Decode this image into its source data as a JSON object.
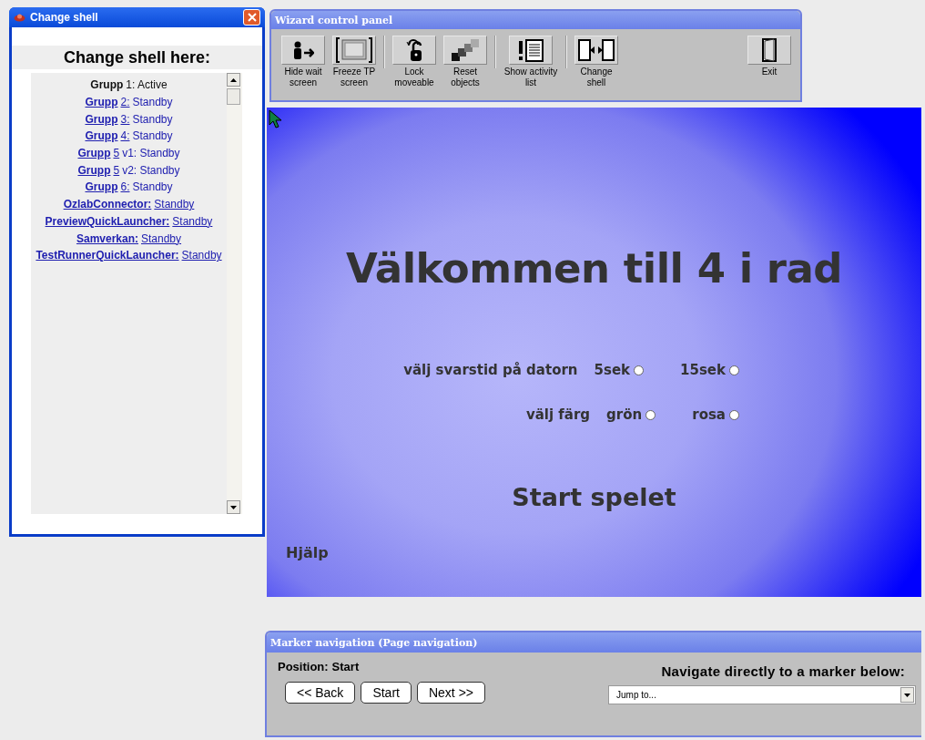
{
  "shell_window": {
    "title": "Change shell",
    "heading": "Change shell here:",
    "items": [
      {
        "active": true,
        "parts": [
          {
            "text": "Grupp",
            "bold": true,
            "link": false
          },
          {
            "text": "1: Active",
            "bold": false,
            "link": false
          }
        ]
      },
      {
        "active": false,
        "parts": [
          {
            "text": "Grupp",
            "bold": true,
            "link": true
          },
          {
            "text": "2:",
            "bold": false,
            "link": true
          },
          {
            "text": "Standby",
            "bold": false,
            "link": false
          }
        ]
      },
      {
        "active": false,
        "parts": [
          {
            "text": "Grupp",
            "bold": true,
            "link": true
          },
          {
            "text": "3:",
            "bold": false,
            "link": true
          },
          {
            "text": "Standby",
            "bold": false,
            "link": false
          }
        ]
      },
      {
        "active": false,
        "parts": [
          {
            "text": "Grupp",
            "bold": true,
            "link": true
          },
          {
            "text": "4:",
            "bold": false,
            "link": true
          },
          {
            "text": "Standby",
            "bold": false,
            "link": false
          }
        ]
      },
      {
        "active": false,
        "parts": [
          {
            "text": "Grupp",
            "bold": true,
            "link": true
          },
          {
            "text": "5",
            "bold": false,
            "link": true
          },
          {
            "text": "v1: Standby",
            "bold": false,
            "link": false
          }
        ]
      },
      {
        "active": false,
        "parts": [
          {
            "text": "Grupp",
            "bold": true,
            "link": true
          },
          {
            "text": "5",
            "bold": false,
            "link": true
          },
          {
            "text": "v2: Standby",
            "bold": false,
            "link": false
          }
        ]
      },
      {
        "active": false,
        "parts": [
          {
            "text": "Grupp",
            "bold": true,
            "link": true
          },
          {
            "text": "6:",
            "bold": false,
            "link": true
          },
          {
            "text": "Standby",
            "bold": false,
            "link": false
          }
        ]
      },
      {
        "active": false,
        "parts": [
          {
            "text": "OzlabConnector:",
            "bold": true,
            "link": true
          },
          {
            "text": "Standby",
            "bold": false,
            "link": true
          }
        ]
      },
      {
        "active": false,
        "parts": [
          {
            "text": "PreviewQuickLauncher:",
            "bold": true,
            "link": true
          },
          {
            "text": "Standby",
            "bold": false,
            "link": true
          }
        ]
      },
      {
        "active": false,
        "parts": [
          {
            "text": "Samverkan:",
            "bold": true,
            "link": true
          },
          {
            "text": "Standby",
            "bold": false,
            "link": true
          }
        ]
      },
      {
        "active": false,
        "parts": [
          {
            "text": "TestRunnerQuickLauncher:",
            "bold": true,
            "link": true
          },
          {
            "text": "Standby",
            "bold": false,
            "link": true
          }
        ]
      }
    ]
  },
  "wizard_panel": {
    "title": "Wizard control panel",
    "groups": [
      [
        {
          "kind": "hide",
          "label": "Hide wait screen"
        },
        {
          "kind": "freeze",
          "label": "Freeze TP screen"
        }
      ],
      [
        {
          "kind": "lock",
          "label": "Lock moveable"
        },
        {
          "kind": "reset",
          "label": "Reset objects"
        }
      ],
      [
        {
          "kind": "activity",
          "label": "Show activity list"
        }
      ],
      [
        {
          "kind": "shell",
          "label": "Change shell"
        }
      ],
      [
        {
          "kind": "exit",
          "label": "Exit"
        }
      ]
    ]
  },
  "stage": {
    "title": "Välkommen till 4 i rad",
    "option_rows": [
      {
        "label": "välj svarstid på datorn",
        "options": [
          {
            "label": "5sek",
            "selected": false
          },
          {
            "label": "15sek",
            "selected": false
          }
        ]
      },
      {
        "label": "välj färg",
        "options": [
          {
            "label": "grön",
            "selected": false
          },
          {
            "label": "rosa",
            "selected": false
          }
        ]
      }
    ],
    "start": "Start spelet",
    "help": "Hjälp"
  },
  "marker_navigation": {
    "title": "Marker navigation (Page navigation)",
    "position_label": "Position:",
    "position": "Start",
    "buttons": [
      "<< Back",
      "Start",
      "Next >>"
    ],
    "navigate_label": "Navigate directly to a marker below:",
    "dropdown": {
      "value": "Jump to..."
    }
  }
}
